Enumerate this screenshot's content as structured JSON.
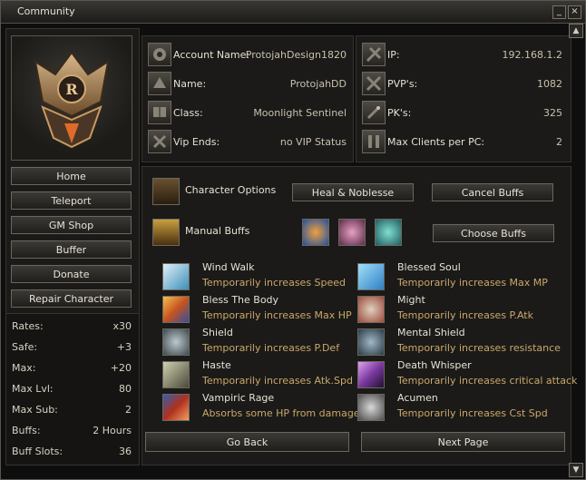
{
  "window": {
    "title": "Community",
    "min_label": "_",
    "close_label": "×"
  },
  "nav": [
    {
      "label": "Home"
    },
    {
      "label": "Teleport"
    },
    {
      "label": "GM Shop"
    },
    {
      "label": "Buffer"
    },
    {
      "label": "Donate"
    },
    {
      "label": "Repair Character"
    }
  ],
  "stats": [
    {
      "key": "Rates:",
      "value": "x30"
    },
    {
      "key": "Safe:",
      "value": "+3"
    },
    {
      "key": "Max:",
      "value": "+20"
    },
    {
      "key": "Max Lvl:",
      "value": "80"
    },
    {
      "key": "Max Sub:",
      "value": "2"
    },
    {
      "key": "Buffs:",
      "value": "2 Hours"
    },
    {
      "key": "Buff Slots:",
      "value": "36"
    }
  ],
  "account": [
    {
      "icon": "account-icon",
      "key": "Account Name:",
      "value": "ProtojahDesign1820"
    },
    {
      "icon": "name-icon",
      "key": "Name:",
      "value": "ProtojahDD"
    },
    {
      "icon": "class-icon",
      "key": "Class:",
      "value": "Moonlight Sentinel"
    },
    {
      "icon": "vip-icon",
      "key": "Vip Ends:",
      "value": "no VIP Status"
    }
  ],
  "server": [
    {
      "icon": "ip-icon",
      "key": "IP:",
      "value": "192.168.1.2"
    },
    {
      "icon": "pvp-icon",
      "key": "PVP's:",
      "value": "1082"
    },
    {
      "icon": "pk-icon",
      "key": "PK's:",
      "value": "325"
    },
    {
      "icon": "clients-icon",
      "key": "Max Clients per PC:",
      "value": "2"
    }
  ],
  "options": {
    "character_options": "Character Options",
    "manual_buffs": "Manual Buffs",
    "heal_noblesse": "Heal & Noblesse",
    "cancel_buffs": "Cancel Buffs",
    "choose_buffs": "Choose Buffs"
  },
  "buffs_left": [
    {
      "name": "Wind Walk",
      "desc": "Temporarily increases Speed",
      "color": "#3c8fb8"
    },
    {
      "name": "Bless The Body",
      "desc": "Temporarily increases Max HP",
      "color": "#c8541e"
    },
    {
      "name": "Shield",
      "desc": "Temporarily increases P.Def",
      "color": "#7a8a8e"
    },
    {
      "name": "Haste",
      "desc": "Temporarily increases Atk.Spd",
      "color": "#8a8a70"
    },
    {
      "name": "Vampiric Rage",
      "desc": "Absorbs some HP from damage",
      "color": "#b0301e"
    }
  ],
  "buffs_right": [
    {
      "name": "Blessed Soul",
      "desc": "Temporarily increases Max MP",
      "color": "#2f7fc4"
    },
    {
      "name": "Might",
      "desc": "Temporarily increases P.Atk",
      "color": "#9a4a3a"
    },
    {
      "name": "Mental Shield",
      "desc": "Temporarily increases resistance",
      "color": "#4e6a7a"
    },
    {
      "name": "Death Whisper",
      "desc": "Temporarily increases critical attack",
      "color": "#7a3aa0"
    },
    {
      "name": "Acumen",
      "desc": "Temporarily increases Cst Spd",
      "color": "#8a8a8a"
    }
  ],
  "footer": {
    "back": "Go Back",
    "next": "Next Page"
  },
  "scroll": {
    "up": "▲",
    "down": "▼"
  }
}
